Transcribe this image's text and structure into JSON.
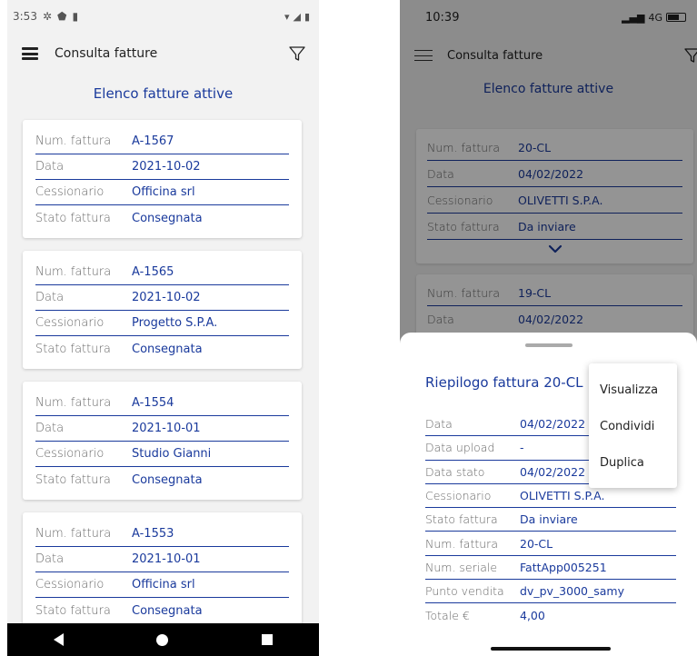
{
  "left_screen": {
    "status_time": "3:53",
    "app_title": "Consulta fatture",
    "list_title": "Elenco fatture attive",
    "labels": {
      "num_fattura": "Num. fattura",
      "data": "Data",
      "cessionario": "Cessionario",
      "stato_fattura": "Stato fattura"
    },
    "invoices": [
      {
        "num": "A-1567",
        "data": "2021-10-02",
        "cessionario": "Officina srl",
        "stato": "Consegnata"
      },
      {
        "num": "A-1565",
        "data": "2021-10-02",
        "cessionario": "Progetto S.P.A.",
        "stato": "Consegnata"
      },
      {
        "num": "A-1554",
        "data": "2021-10-01",
        "cessionario": "Studio Gianni",
        "stato": "Consegnata"
      },
      {
        "num": "A-1553",
        "data": "2021-10-01",
        "cessionario": "Officina srl",
        "stato": "Consegnata"
      }
    ]
  },
  "right_screen": {
    "status_time": "10:39",
    "network": "4G",
    "app_title": "Consulta fatture",
    "list_title": "Elenco fatture attive",
    "labels": {
      "num_fattura": "Num. fattura",
      "data": "Data",
      "cessionario": "Cessionario",
      "stato_fattura": "Stato fattura"
    },
    "invoices": [
      {
        "num": "20-CL",
        "data": "04/02/2022",
        "cessionario": "OLIVETTI S.P.A.",
        "stato": "Da inviare"
      },
      {
        "num": "19-CL",
        "data": "04/02/2022"
      }
    ],
    "sheet": {
      "title": "Riepilogo fattura 20-CL",
      "rows": [
        {
          "label": "Data",
          "value": "04/02/2022"
        },
        {
          "label": "Data upload",
          "value": "-"
        },
        {
          "label": "Data stato",
          "value": "04/02/2022"
        },
        {
          "label": "Cessionario",
          "value": "OLIVETTI S.P.A."
        },
        {
          "label": "Stato fattura",
          "value": "Da inviare"
        },
        {
          "label": "Num. fattura",
          "value": "20-CL"
        },
        {
          "label": "Num. seriale",
          "value": "FattApp005251"
        },
        {
          "label": "Punto vendita",
          "value": "dv_pv_3000_samy"
        },
        {
          "label": "Totale €",
          "value": "4,00"
        }
      ]
    },
    "menu": {
      "items": [
        "Visualizza",
        "Condividi",
        "Duplica"
      ]
    }
  },
  "colors": {
    "accent_blue": "#1a3a9c",
    "background": "#f2f2f2"
  }
}
